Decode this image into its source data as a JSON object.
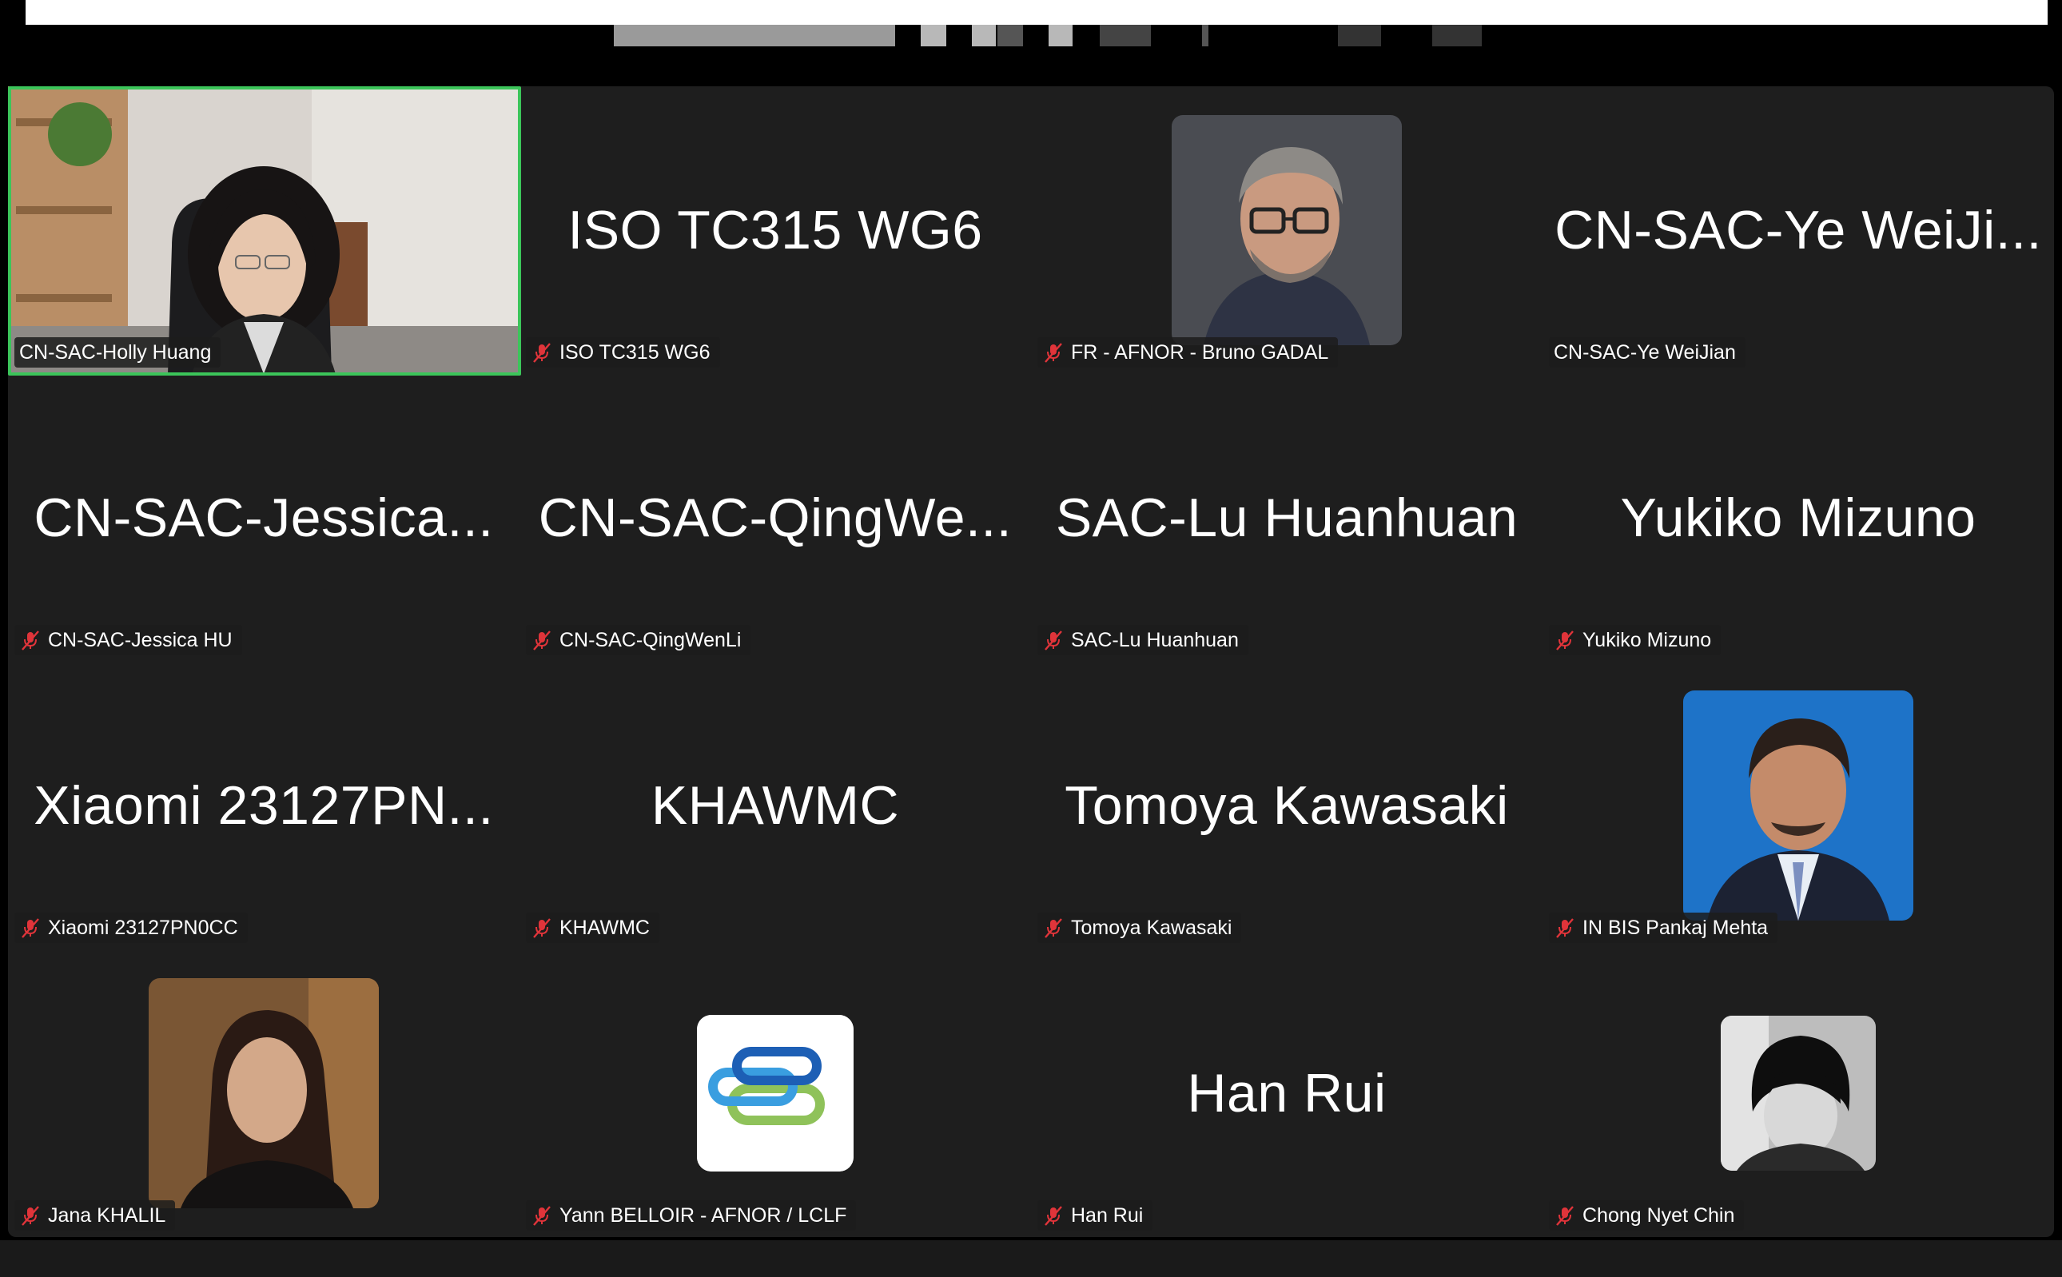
{
  "window": {
    "top_bar_color": "#ffffff"
  },
  "gallery": {
    "background": "#1e1e1e",
    "active_speaker_border_color": "#3cc55a",
    "tiles": [
      {
        "big_name": "",
        "label": "CN-SAC-Holly Huang",
        "muted": false,
        "media": "video"
      },
      {
        "big_name": "ISO TC315 WG6",
        "label": "ISO TC315 WG6",
        "muted": true,
        "media": "name"
      },
      {
        "big_name": "",
        "label": "FR - AFNOR - Bruno GADAL",
        "muted": true,
        "media": "photo"
      },
      {
        "big_name": "CN-SAC-Ye WeiJi...",
        "label": "CN-SAC-Ye WeiJian",
        "muted": false,
        "media": "name"
      },
      {
        "big_name": "CN-SAC-Jessica...",
        "label": "CN-SAC-Jessica HU",
        "muted": true,
        "media": "name"
      },
      {
        "big_name": "CN-SAC-QingWe...",
        "label": "CN-SAC-QingWenLi",
        "muted": true,
        "media": "name"
      },
      {
        "big_name": "SAC-Lu Huanhuan",
        "label": "SAC-Lu Huanhuan",
        "muted": true,
        "media": "name"
      },
      {
        "big_name": "Yukiko Mizuno",
        "label": "Yukiko Mizuno",
        "muted": true,
        "media": "name"
      },
      {
        "big_name": "Xiaomi 23127PN...",
        "label": "Xiaomi 23127PN0CC",
        "muted": true,
        "media": "name"
      },
      {
        "big_name": "KHAWMC",
        "label": "KHAWMC",
        "muted": true,
        "media": "name"
      },
      {
        "big_name": "Tomoya Kawasaki",
        "label": "Tomoya Kawasaki",
        "muted": true,
        "media": "name"
      },
      {
        "big_name": "",
        "label": "IN BIS Pankaj Mehta",
        "muted": true,
        "media": "photo"
      },
      {
        "big_name": "",
        "label": "Jana KHALIL",
        "muted": true,
        "media": "photo"
      },
      {
        "big_name": "",
        "label": "Yann BELLOIR - AFNOR / LCLF",
        "muted": true,
        "media": "logo"
      },
      {
        "big_name": "Han Rui",
        "label": "Han Rui",
        "muted": true,
        "media": "name"
      },
      {
        "big_name": "",
        "label": "Chong Nyet Chin",
        "muted": true,
        "media": "photo"
      }
    ]
  }
}
